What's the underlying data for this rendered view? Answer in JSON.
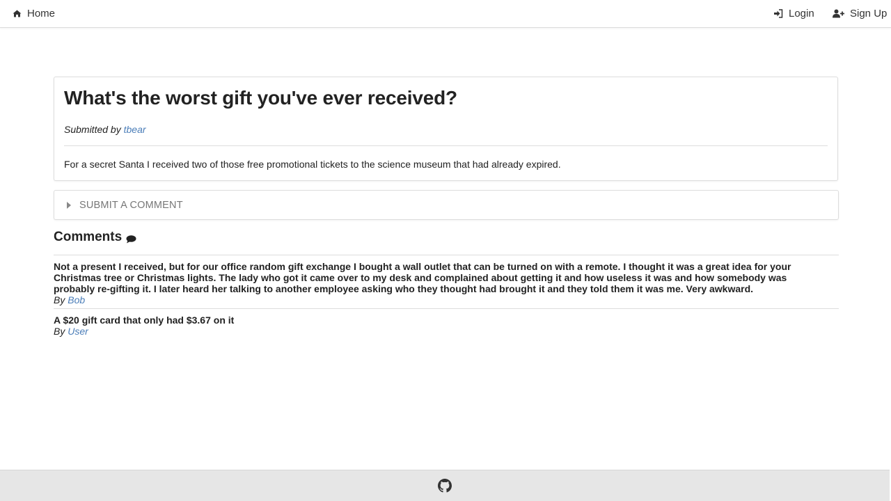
{
  "nav": {
    "home_label": "Home",
    "login_label": "Login",
    "signup_label": "Sign Up"
  },
  "post": {
    "title": "What's the worst gift you've ever received?",
    "submitted_by_prefix": "Submitted by",
    "author": "tbear",
    "body": "For a secret Santa I received two of those free promotional tickets to the science museum that had already expired."
  },
  "submit_comment": {
    "label": "Submit a comment"
  },
  "comments": {
    "heading": "Comments",
    "by_prefix": "By",
    "items": [
      {
        "text": "Not a present I received, but for our office random gift exchange I bought a wall outlet that can be turned on with a remote. I thought it was a great idea for your Christmas tree or Christmas lights. The lady who got it came over to my desk and complained about getting it and how useless it was and how somebody was probably re-gifting it. I later heard her talking to another employee asking who they thought had brought it and they told them it was me. Very awkward.",
        "author": "Bob"
      },
      {
        "text": "A $20 gift card that only had $3.67 on it",
        "author": "User"
      }
    ]
  },
  "colors": {
    "link": "#4a7db8",
    "footer_bg": "#e6e6e6"
  },
  "icons": {
    "home": "home-icon",
    "login": "sign-in-icon",
    "signup": "user-plus-icon",
    "caret": "caret-right-icon",
    "comments": "comment-icon",
    "footer": "github-icon"
  }
}
